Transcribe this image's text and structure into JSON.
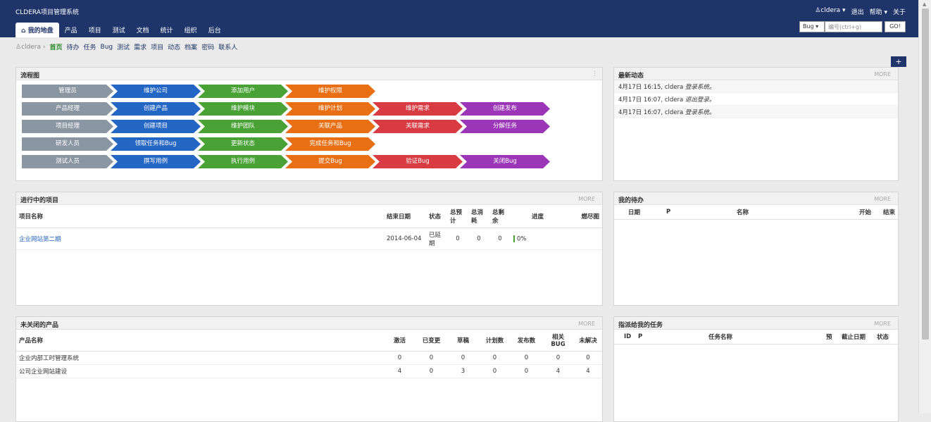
{
  "app": {
    "title": "CLDERA项目管理系统"
  },
  "userbar": {
    "user": "cldera ▾",
    "logout": "退出",
    "help": "帮助 ▾",
    "about": "关于"
  },
  "nav": {
    "tabs": [
      {
        "label": "我的地盘",
        "active": true
      },
      {
        "label": "产品"
      },
      {
        "label": "项目"
      },
      {
        "label": "测试"
      },
      {
        "label": "文档"
      },
      {
        "label": "统计"
      },
      {
        "label": "组织"
      },
      {
        "label": "后台"
      }
    ]
  },
  "search": {
    "type": "Bug ▾",
    "placeholder": "编号(ctrl+g)",
    "go": "GO!"
  },
  "subnav": {
    "home": "cldera",
    "items": [
      "首页",
      "待办",
      "任务",
      "Bug",
      "测试",
      "需求",
      "项目",
      "动态",
      "档案",
      "密码",
      "联系人"
    ]
  },
  "flowchart": {
    "title": "流程图",
    "rows": [
      [
        "管理员",
        "维护公司",
        "添加用户",
        "维护权限"
      ],
      [
        "产品经理",
        "创建产品",
        "维护模块",
        "维护计划",
        "维护需求",
        "创建发布"
      ],
      [
        "项目经理",
        "创建项目",
        "维护团队",
        "关联产品",
        "关联需求",
        "分解任务"
      ],
      [
        "研发人员",
        "领取任务和Bug",
        "更新状态",
        "完成任务和Bug"
      ],
      [
        "测试人员",
        "撰写用例",
        "执行用例",
        "提交Bug",
        "验证Bug",
        "关闭Bug"
      ]
    ]
  },
  "activity": {
    "title": "最新动态",
    "more": "MORE",
    "items": [
      {
        "text": "4月17日 16:15, cldera ",
        "action": "登录系统。"
      },
      {
        "text": "4月17日 16:07, cldera ",
        "action": "退出登录。"
      },
      {
        "text": "4月17日 16:07, cldera ",
        "action": "登录系统。"
      }
    ]
  },
  "projects": {
    "title": "进行中的项目",
    "more": "MORE",
    "headers": [
      "项目名称",
      "结束日期",
      "状态",
      "总预计",
      "总消耗",
      "总剩余",
      "进度",
      "燃尽图"
    ],
    "rows": [
      {
        "name": "企业网站第二期",
        "end": "2014-06-04",
        "status": "已延期",
        "estimate": "0",
        "consumed": "0",
        "left": "0",
        "progress": "0%"
      }
    ]
  },
  "todo": {
    "title": "我的待办",
    "more": "MORE",
    "headers": [
      "日期",
      "P",
      "名称",
      "开始",
      "结束"
    ]
  },
  "products": {
    "title": "未关闭的产品",
    "more": "MORE",
    "headers": [
      "产品名称",
      "激活",
      "已变更",
      "草稿",
      "计划数",
      "发布数",
      "相关BUG",
      "未解决"
    ],
    "rows": [
      {
        "name": "企业内部工时管理系统",
        "cells": [
          "0",
          "0",
          "0",
          "0",
          "0",
          "0",
          "0"
        ]
      },
      {
        "name": "公司企业网站建设",
        "cells": [
          "4",
          "0",
          "3",
          "0",
          "0",
          "4",
          "4"
        ]
      }
    ]
  },
  "tasks": {
    "title": "指派给我的任务",
    "more": "MORE",
    "headers": [
      "ID",
      "P",
      "任务名称",
      "预",
      "截止日期",
      "状态"
    ]
  },
  "colors": {
    "topbar": "#1f3569",
    "role": "#8b96a3",
    "blue": "#2366c4",
    "green": "#4aa136",
    "orange": "#e86f13",
    "red": "#d93b42",
    "purple": "#9c36b8"
  }
}
